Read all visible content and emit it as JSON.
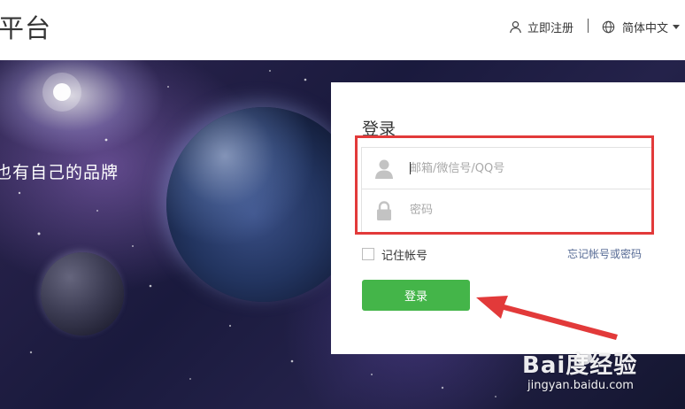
{
  "header": {
    "brand_text": "平台",
    "register_label": "立即注册",
    "language_label": "简体中文"
  },
  "banner": {
    "slogan": "也有自己的品牌"
  },
  "login": {
    "title": "登录",
    "account_placeholder": "邮箱/微信号/QQ号",
    "password_placeholder": "密码",
    "remember_label": "记住帐号",
    "forgot_label": "忘记帐号或密码",
    "button_label": "登录",
    "remember_checked": false
  },
  "watermark": {
    "logo": "Bai度经验",
    "url": "jingyan.baidu.com"
  },
  "icons": {
    "register": "user-icon",
    "language": "globe-icon",
    "language_toggle": "caret-down-icon",
    "account": "user-icon",
    "password": "lock-icon"
  },
  "colors": {
    "login_button": "#44b549",
    "forgot_link": "#576b95",
    "annotation": "#e23a3a"
  }
}
